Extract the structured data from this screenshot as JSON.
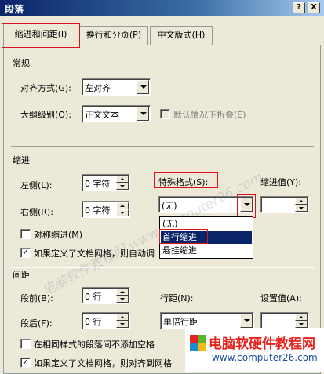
{
  "window": {
    "title": "段落",
    "help_label": "?",
    "close_label": "X"
  },
  "tabs": [
    {
      "label": "缩进和间距(I)",
      "active": true
    },
    {
      "label": "换行和分页(P)",
      "active": false
    },
    {
      "label": "中文版式(H)",
      "active": false
    }
  ],
  "general": {
    "title": "常规",
    "alignment_label": "对齐方式(G):",
    "alignment_value": "左对齐",
    "outline_label": "大纲级别(O):",
    "outline_value": "正文文本",
    "collapse_label": "默认情况下折叠(E)"
  },
  "indent": {
    "title": "缩进",
    "left_label": "左侧(L):",
    "left_value": "0 字符",
    "right_label": "右侧(R):",
    "right_value": "0 字符",
    "special_label": "特殊格式(S):",
    "special_value": "(无)",
    "by_label": "缩进值(Y):",
    "by_value": "",
    "special_options": [
      "(无)",
      "首行缩进",
      "悬挂缩进"
    ],
    "special_highlighted": "首行缩进",
    "mirror_label": "对称缩进(M)",
    "mirror_checked": false,
    "auto_adjust_label": "如果定义了文档网格，则自动调",
    "auto_adjust_checked": true
  },
  "spacing": {
    "title": "间距",
    "before_label": "段前(B):",
    "before_value": "0 行",
    "after_label": "段后(F):",
    "after_value": "0 行",
    "line_label": "行距(N):",
    "line_value": "单倍行距",
    "at_label": "设置值(A):",
    "at_value": "",
    "no_space_label": "在相同样式的段落间不添加空格",
    "no_space_checked": false,
    "snap_grid_label": "如果定义了文档网格，则对齐到网格",
    "snap_grid_checked": true
  },
  "watermark": {
    "text": "电脑软件教程网 www.computer26.com"
  },
  "brand": {
    "name": "电脑软硬件教程网",
    "url": "www.computer26.com",
    "colors": {
      "red": "#e8231c",
      "green": "#5bb52b",
      "blue": "#1d8ad6",
      "yellow": "#f5b915"
    }
  }
}
